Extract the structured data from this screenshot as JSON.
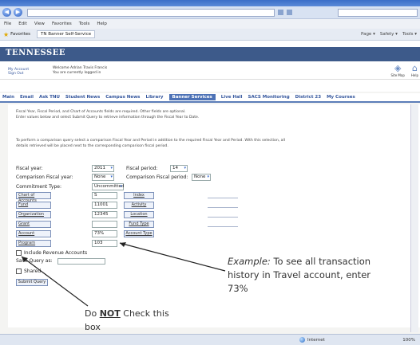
{
  "browser": {
    "back_label": "◀",
    "forward_label": "▶",
    "favorites_label": "Favorites",
    "fav_tab_label": "TN Banner Self-Service",
    "tools": [
      "Page ▾",
      "Safety ▾",
      "Tools ▾"
    ]
  },
  "menu": {
    "items": [
      "File",
      "Edit",
      "View",
      "Favorites",
      "Tools",
      "Help"
    ]
  },
  "site": {
    "logo": "TENNESSEE",
    "logout_line1": "My Account",
    "logout_line2": "Sign Out",
    "welcome_line1": "Welcome Adrian Travis Francis",
    "welcome_line2": "You are currently logged in",
    "icons": [
      {
        "name": "site-map-icon",
        "glyph": "◈",
        "label": "Site Map"
      },
      {
        "name": "help-icon",
        "glyph": "⌂",
        "label": "Help"
      }
    ]
  },
  "tabs": [
    {
      "label": "Main",
      "active": false
    },
    {
      "label": "Email",
      "active": false
    },
    {
      "label": "Ask TNU",
      "active": false
    },
    {
      "label": "Student News",
      "active": false
    },
    {
      "label": "Campus News",
      "active": false
    },
    {
      "label": "Library",
      "active": false
    },
    {
      "label": "Banner Services",
      "active": true
    },
    {
      "label": "Live Hall",
      "active": false
    },
    {
      "label": "SACS Monitoring",
      "active": false
    },
    {
      "label": "District 23",
      "active": false
    },
    {
      "label": "My Courses",
      "active": false
    }
  ],
  "info": {
    "line1": "Fiscal Year, Fiscal Period, and Chart of Accounts fields are required. Other fields are optional.",
    "line2": "Enter values below and select Submit Query to retrieve information through the Fiscal Year to Date.",
    "line3": "To perform a comparison query select a comparison Fiscal Year and Period in addition to the required Fiscal Year and Period. With this selection, all",
    "line4": "details retrieved will be placed next to the corresponding comparison fiscal period."
  },
  "form": {
    "fiscal_year_label": "Fiscal year:",
    "fiscal_year_value": "2011",
    "fiscal_period_label": "Fiscal period:",
    "fiscal_period_value": "14",
    "comparison_year_label": "Comparison Fiscal year:",
    "comparison_year_value": "None",
    "comparison_period_label": "Comparison Fiscal period:",
    "comparison_period_value": "None",
    "commitment_label": "Commitment Type:",
    "commitment_value": "Uncommitted",
    "fields": [
      {
        "label": "Chart of Accounts",
        "value": "S",
        "right": "Index"
      },
      {
        "label": "Fund",
        "value": "11001",
        "right": "Activity"
      },
      {
        "label": "Organization",
        "value": "12345",
        "right": "Location"
      },
      {
        "label": "Grant",
        "value": "",
        "right": "Fund Type"
      },
      {
        "label": "Account",
        "value": "73%",
        "right": "Account Type"
      },
      {
        "label": "Program",
        "value": "103",
        "right": ""
      }
    ],
    "include_revenue_label": "Include Revenue Accounts",
    "save_query_label": "Save Query as:",
    "shared_label": "Shared",
    "submit_label": "Submit Query"
  },
  "annotations": {
    "example_label": "Example:",
    "example_text": "To see all transaction history in Travel account, enter 73%",
    "note_prefix": "Do",
    "note_bold": "NOT",
    "note_suffix": "Check this box"
  },
  "status": {
    "zone_label": "Internet",
    "zoom_label": "100%"
  }
}
